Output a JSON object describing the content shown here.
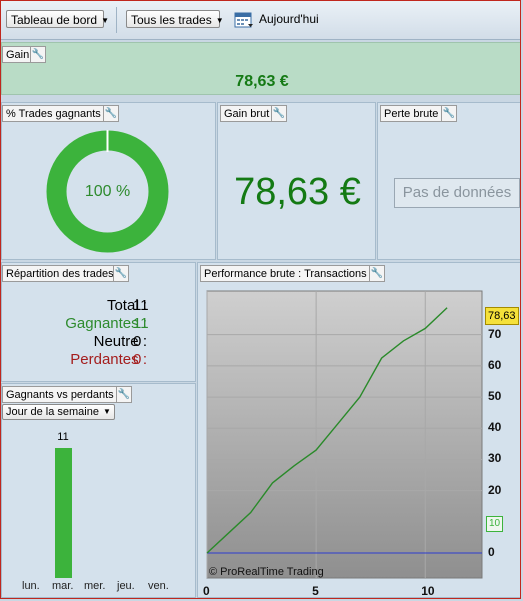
{
  "toolbar": {
    "view_select": "Tableau de bord",
    "trades_select": "Tous les trades",
    "date_label": "Aujourd'hui"
  },
  "gain_panel": {
    "title": "Gain",
    "value": "78,63 €"
  },
  "win_pct_panel": {
    "title": "% Trades gagnants",
    "value": "100 %",
    "percent": 100
  },
  "gross_gain_panel": {
    "title": "Gain brut",
    "value": "78,63 €"
  },
  "gross_loss_panel": {
    "title": "Perte brute",
    "no_data": "Pas de données"
  },
  "distribution_panel": {
    "title": "Répartition des trades",
    "rows": [
      {
        "label": "Total",
        "sep": " : ",
        "value": "11"
      },
      {
        "label": "Gagnantes",
        "sep": " : ",
        "value": "11"
      },
      {
        "label": "Neutre",
        "sep": " : ",
        "value": "0"
      },
      {
        "label": "Perdantes",
        "sep": " : ",
        "value": "0"
      }
    ]
  },
  "winners_losers_panel": {
    "title": "Gagnants vs perdants",
    "select": "Jour de la semaine",
    "days": [
      "lun.",
      "mar.",
      "mer.",
      "jeu.",
      "ven."
    ],
    "counts": [
      0,
      11,
      0,
      0,
      0
    ],
    "bar_label": "11"
  },
  "performance_panel": {
    "title": "Performance brute : Transactions",
    "watermark": "© ProRealTime Trading",
    "last_value_badge": "78,63",
    "marker_badge": "10"
  },
  "chart_data": {
    "type": "line",
    "x": [
      0,
      1,
      2,
      3,
      4,
      5,
      6,
      7,
      8,
      9,
      10,
      11
    ],
    "y": [
      0,
      6.5,
      13,
      22.5,
      28,
      33,
      41.5,
      50,
      62.5,
      68,
      72,
      78.63
    ],
    "xlim": [
      0,
      12.6
    ],
    "ylim": [
      -8,
      84
    ],
    "xticks": [
      "0",
      "5",
      "10"
    ],
    "yticks": [
      "70",
      "60",
      "50",
      "40",
      "30",
      "20",
      "0"
    ],
    "baseline": 0,
    "grid": true
  },
  "colors": {
    "line": "#2a8a2a",
    "baseline": "#2b3bd0",
    "accent_green": "#3cb33c",
    "badge_yellow": "#f5e13a"
  }
}
